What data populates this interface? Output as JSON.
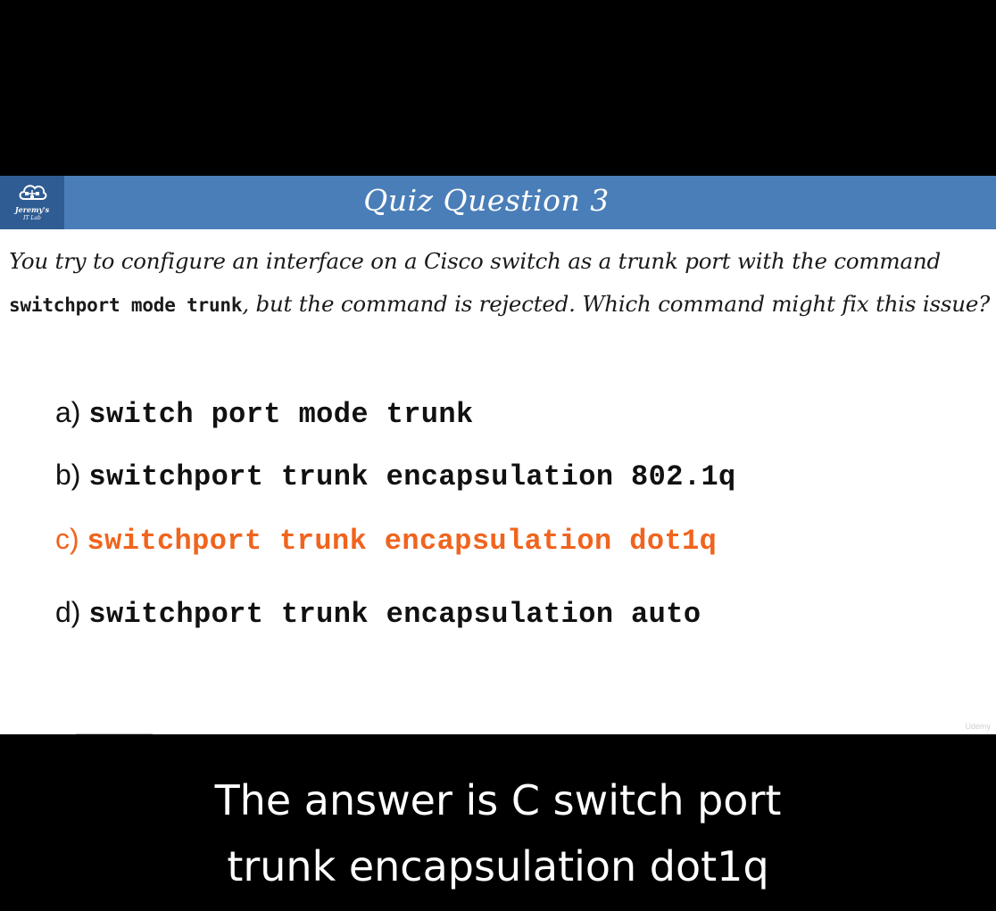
{
  "slide": {
    "logo": {
      "line1": "Jeremy's",
      "line2": "IT Lab"
    },
    "title": "Quiz Question 3",
    "question": {
      "before": "You try to configure an interface on a Cisco switch as a trunk port with the command ",
      "code": "switchport mode trunk",
      "after": ", but the command is rejected.  Which command might fix this issue?"
    },
    "options": [
      {
        "letter": "a)",
        "command": "switch port mode trunk",
        "correct": false
      },
      {
        "letter": "b)",
        "command": "switchport trunk encapsulation 802.1q",
        "correct": false
      },
      {
        "letter": "c)",
        "command": "switchport trunk encapsulation dot1q",
        "correct": true
      },
      {
        "letter": "d)",
        "command": "switchport trunk encapsulation auto",
        "correct": false
      }
    ],
    "watermark": "Udemy"
  },
  "caption": {
    "line1": "The answer is C switch port",
    "line2": "trunk encapsulation dot1q"
  },
  "colors": {
    "title_bar": "#4a7eb8",
    "logo_box": "#2f5d93",
    "correct_answer": "#f0641e",
    "background": "#000000"
  }
}
